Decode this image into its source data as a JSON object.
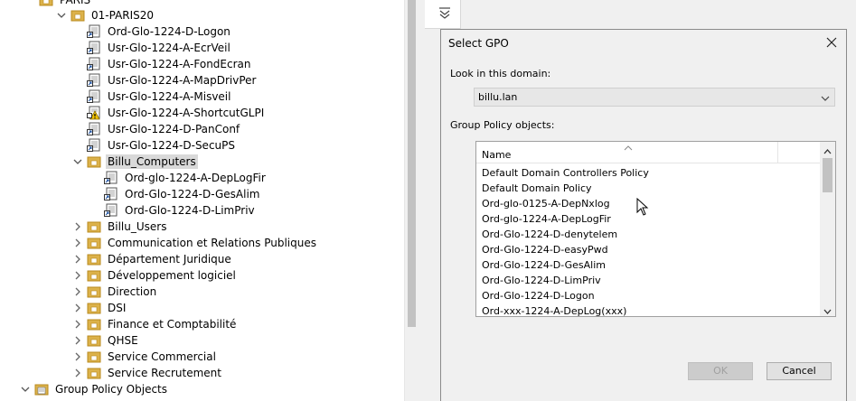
{
  "tree": {
    "partial_top": "PARIS",
    "ou_paris20": "01-PARIS20",
    "paris20_items": [
      {
        "label": "Ord-Glo-1224-D-Logon",
        "warn": false
      },
      {
        "label": "Usr-Glo-1224-A-EcrVeil",
        "warn": false
      },
      {
        "label": "Usr-Glo-1224-A-FondEcran",
        "warn": false
      },
      {
        "label": "Usr-Glo-1224-A-MapDrivPer",
        "warn": false
      },
      {
        "label": "Usr-Glo-1224-A-Misveil",
        "warn": false
      },
      {
        "label": "Usr-Glo-1224-A-ShortcutGLPI",
        "warn": true
      },
      {
        "label": "Usr-Glo-1224-D-PanConf",
        "warn": false
      },
      {
        "label": "Usr-Glo-1224-D-SecuPS",
        "warn": false
      }
    ],
    "ou_billu_computers": "Billu_Computers",
    "computers_items": [
      "Ord-glo-1224-A-DepLogFir",
      "Ord-Glo-1224-D-GesAlim",
      "Ord-Glo-1224-D-LimPriv"
    ],
    "ous": [
      "Billu_Users",
      "Communication et Relations Publiques",
      "Département Juridique",
      "Développement logiciel",
      "Direction",
      "DSI",
      "Finance et Comptabilité",
      "QHSE",
      "Service Commercial",
      "Service Recrutement"
    ],
    "gpo_root": "Group Policy Objects"
  },
  "dialog": {
    "title": "Select GPO",
    "domain_label": "Look in this domain:",
    "domain_value": "billu.lan",
    "gpo_label": "Group Policy objects:",
    "column_name": "Name",
    "gpos": [
      "Default Domain Controllers Policy",
      "Default Domain Policy",
      "Ord-glo-0125-A-DepNxlog",
      "Ord-glo-1224-A-DepLogFir",
      "Ord-Glo-1224-D-denytelem",
      "Ord-Glo-1224-D-easyPwd",
      "Ord-Glo-1224-D-GesAlim",
      "Ord-Glo-1224-D-LimPriv",
      "Ord-Glo-1224-D-Logon",
      "Ord-xxx-1224-A-DepLog(xxx)"
    ],
    "ok_label": "OK",
    "cancel_label": "Cancel"
  },
  "icons": {
    "folder": "ou-folder-icon",
    "gpo_link": "gpo-link-icon",
    "gpo_root": "gpo-container-icon",
    "close": "close-icon",
    "filter": "filter-icon"
  },
  "colors": {
    "folder": "#dcb24b",
    "folder_dark": "#b98a1e",
    "selection": "#d9d9d9",
    "dialog_bg": "#f0f0f0"
  }
}
